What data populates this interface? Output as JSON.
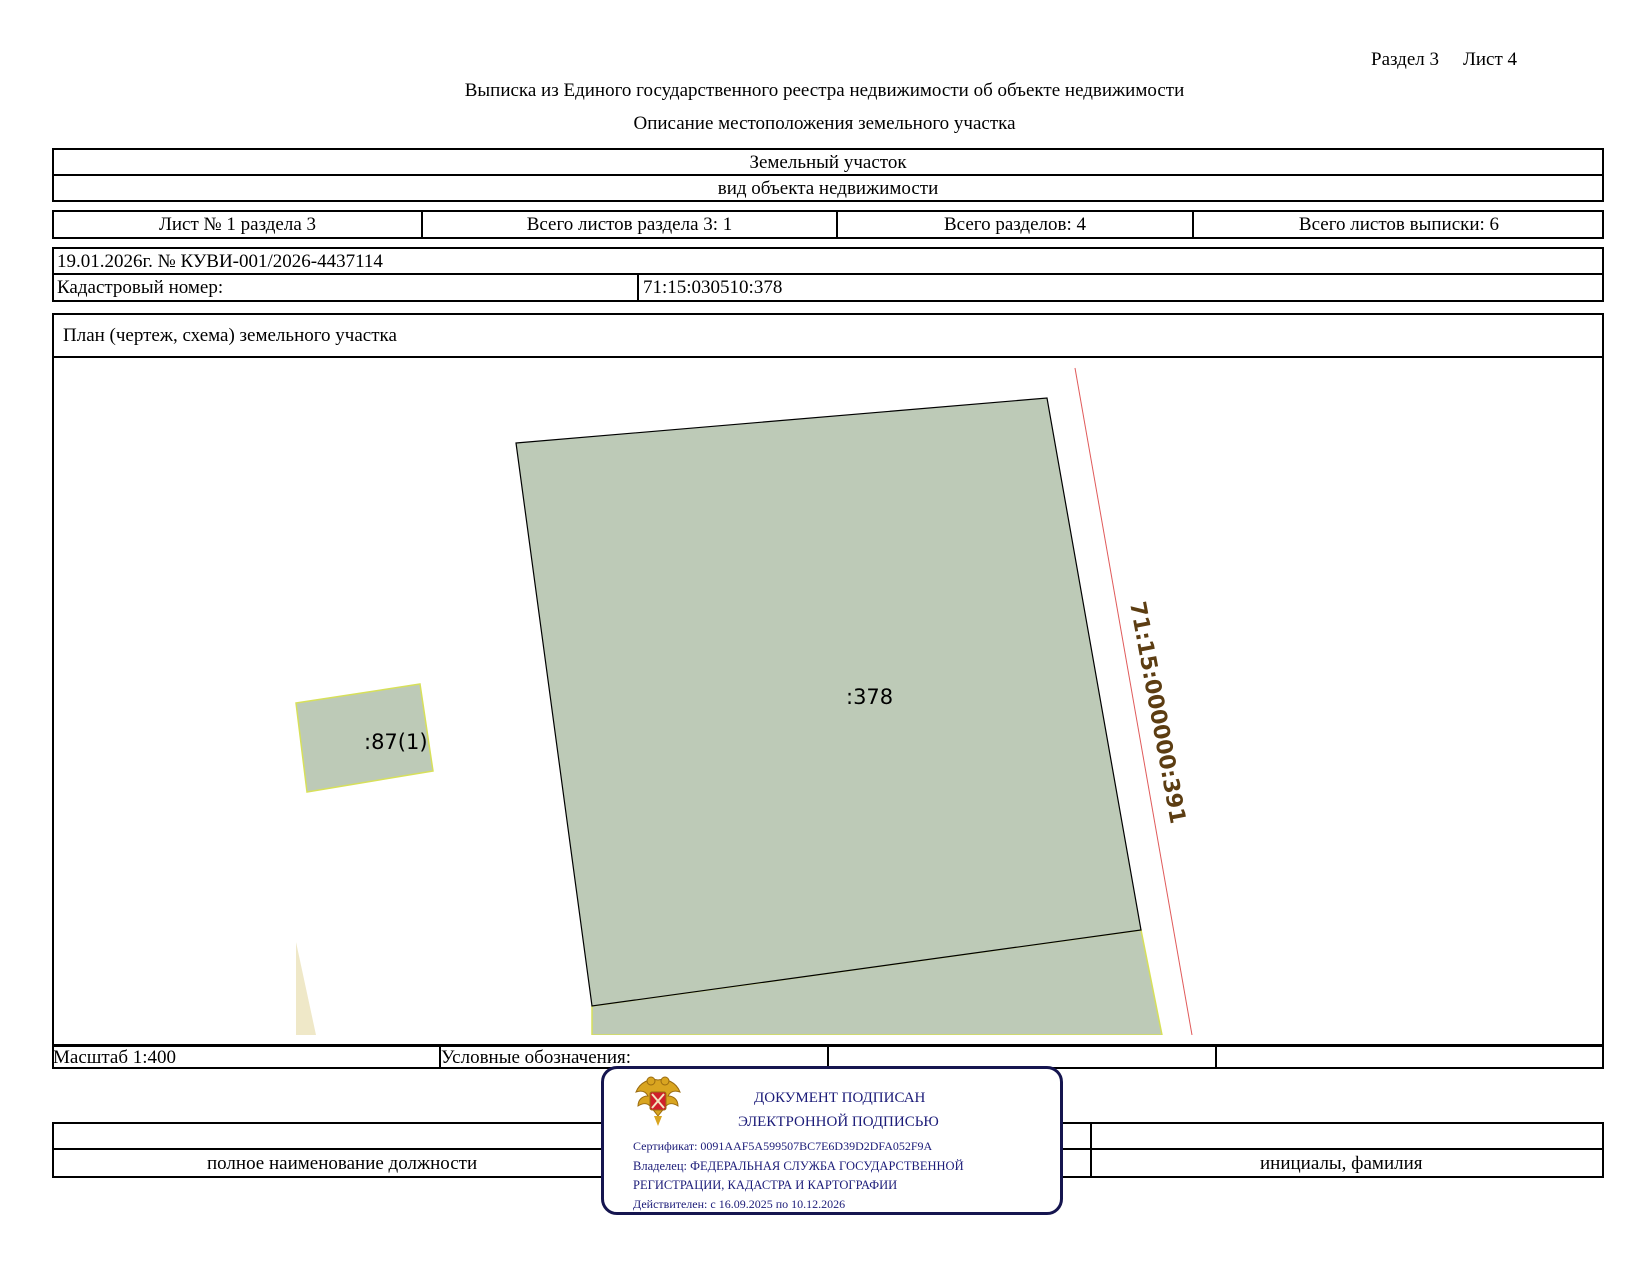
{
  "header": {
    "section_label": "Раздел 3",
    "sheet_label": "Лист 4",
    "title": "Выписка из Единого государственного реестра недвижимости об объекте недвижимости",
    "subtitle": "Описание местоположения земельного участка"
  },
  "object": {
    "type_value": "Земельный участок",
    "type_caption": "вид объекта недвижимости"
  },
  "sheets_row": {
    "sheet_no": "Лист № 1 раздела 3",
    "sheets_in_section": "Всего листов раздела 3: 1",
    "sections_total": "Всего разделов: 4",
    "extract_sheets_total": "Всего листов выписки: 6"
  },
  "record": {
    "date_number": "19.01.2026г. № КУВИ-001/2026-4437114",
    "cadastral_label": "Кадастровый номер:",
    "cadastral_value": "71:15:030510:378"
  },
  "plan": {
    "heading": "План (чертеж, схема) земельного участка",
    "parcel_main_label": ":378",
    "parcel_small_label": ":87(1)",
    "boundary_label": "71:15:000000:391",
    "colors": {
      "parcel_fill": "#bdcab7",
      "parcel_border_main": "#000000",
      "parcel_border_neighbor": "#d7e05a",
      "boundary_line": "#e05a5a",
      "boundary_text": "#5c3d12",
      "sliver_fill": "#efe8c8"
    }
  },
  "legend_row": {
    "scale": "Масштаб 1:400",
    "legend_label": "Условные обозначения:"
  },
  "signature_row": {
    "position_caption": "полное наименование должности",
    "name_caption": "инициалы, фамилия"
  },
  "stamp": {
    "emblem_icon": "coat-of-arms-icon",
    "line1": "ДОКУМЕНТ ПОДПИСАН",
    "line2": "ЭЛЕКТРОННОЙ ПОДПИСЬЮ",
    "certificate": "Сертификат: 0091AAF5A599507BC7E6D39D2DFA052F9A",
    "owner_line1": "Владелец: ФЕДЕРАЛЬНАЯ СЛУЖБА ГОСУДАРСТВЕННОЙ",
    "owner_line2": "РЕГИСТРАЦИИ, КАДАСТРА И КАРТОГРАФИИ",
    "valid": "Действителен: с 16.09.2025 по 10.12.2026",
    "border_color": "#15154f",
    "text_color": "#1b1b78"
  }
}
